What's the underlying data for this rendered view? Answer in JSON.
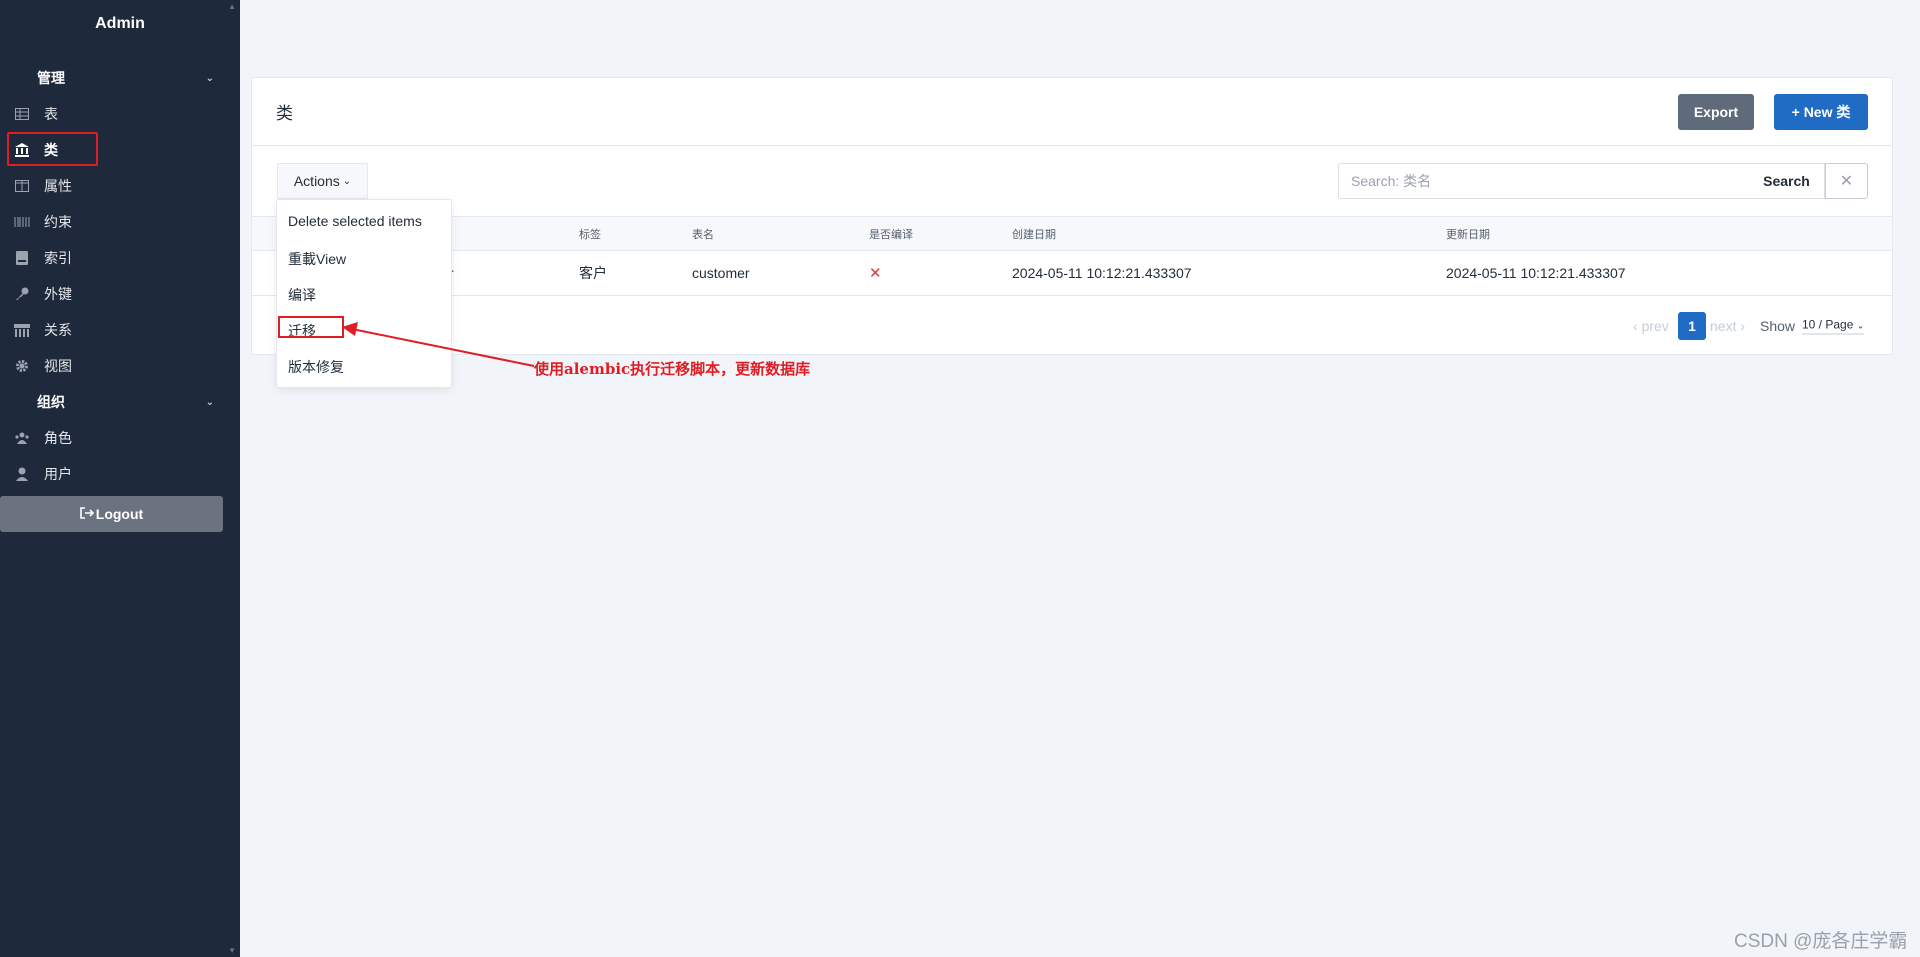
{
  "sidebar": {
    "brand": "Admin",
    "sections": [
      {
        "label": "管理",
        "items": [
          {
            "label": "表",
            "icon": "table-icon"
          },
          {
            "label": "类",
            "icon": "bank-icon",
            "active": true
          },
          {
            "label": "属性",
            "icon": "columns-icon"
          },
          {
            "label": "约束",
            "icon": "barcode-icon"
          },
          {
            "label": "索引",
            "icon": "book-icon"
          },
          {
            "label": "外键",
            "icon": "key-icon"
          },
          {
            "label": "关系",
            "icon": "store-icon"
          },
          {
            "label": "视图",
            "icon": "gear-icon"
          }
        ]
      },
      {
        "label": "组织",
        "items": [
          {
            "label": "角色",
            "icon": "users-icon"
          },
          {
            "label": "用户",
            "icon": "user-icon"
          }
        ]
      }
    ],
    "logout_label": "Logout"
  },
  "page": {
    "title": "类",
    "export_label": "Export",
    "new_label": "+ New 类"
  },
  "toolbar": {
    "actions_label": "Actions",
    "search_placeholder": "Search: 类名",
    "search_label": "Search",
    "clear_label": "✕"
  },
  "dropdown": {
    "items": [
      "Delete selected items",
      "重載View",
      "编译",
      "迁移",
      "版本修复"
    ]
  },
  "table": {
    "columns": [
      "标签",
      "表名",
      "是否编译",
      "创建日期",
      "更新日期"
    ],
    "rows": [
      {
        "name_fragment": "r",
        "label": "客户",
        "table_name": "customer",
        "compiled": "✕",
        "created": "2024-05-11 10:12:21.433307",
        "updated": "2024-05-11 10:12:21.433307"
      }
    ]
  },
  "pagination": {
    "prev": "prev",
    "current": "1",
    "next": "next",
    "show_label": "Show",
    "per_page": "10 / Page"
  },
  "annotation": "使用alembic执行迁移脚本，更新数据库",
  "watermark": "CSDN @庞各庄学霸",
  "colors": {
    "sidebar_bg": "#1e293b",
    "primary": "#206bc4",
    "secondary": "#5f6b7a",
    "annotation_red": "#e11d24"
  }
}
